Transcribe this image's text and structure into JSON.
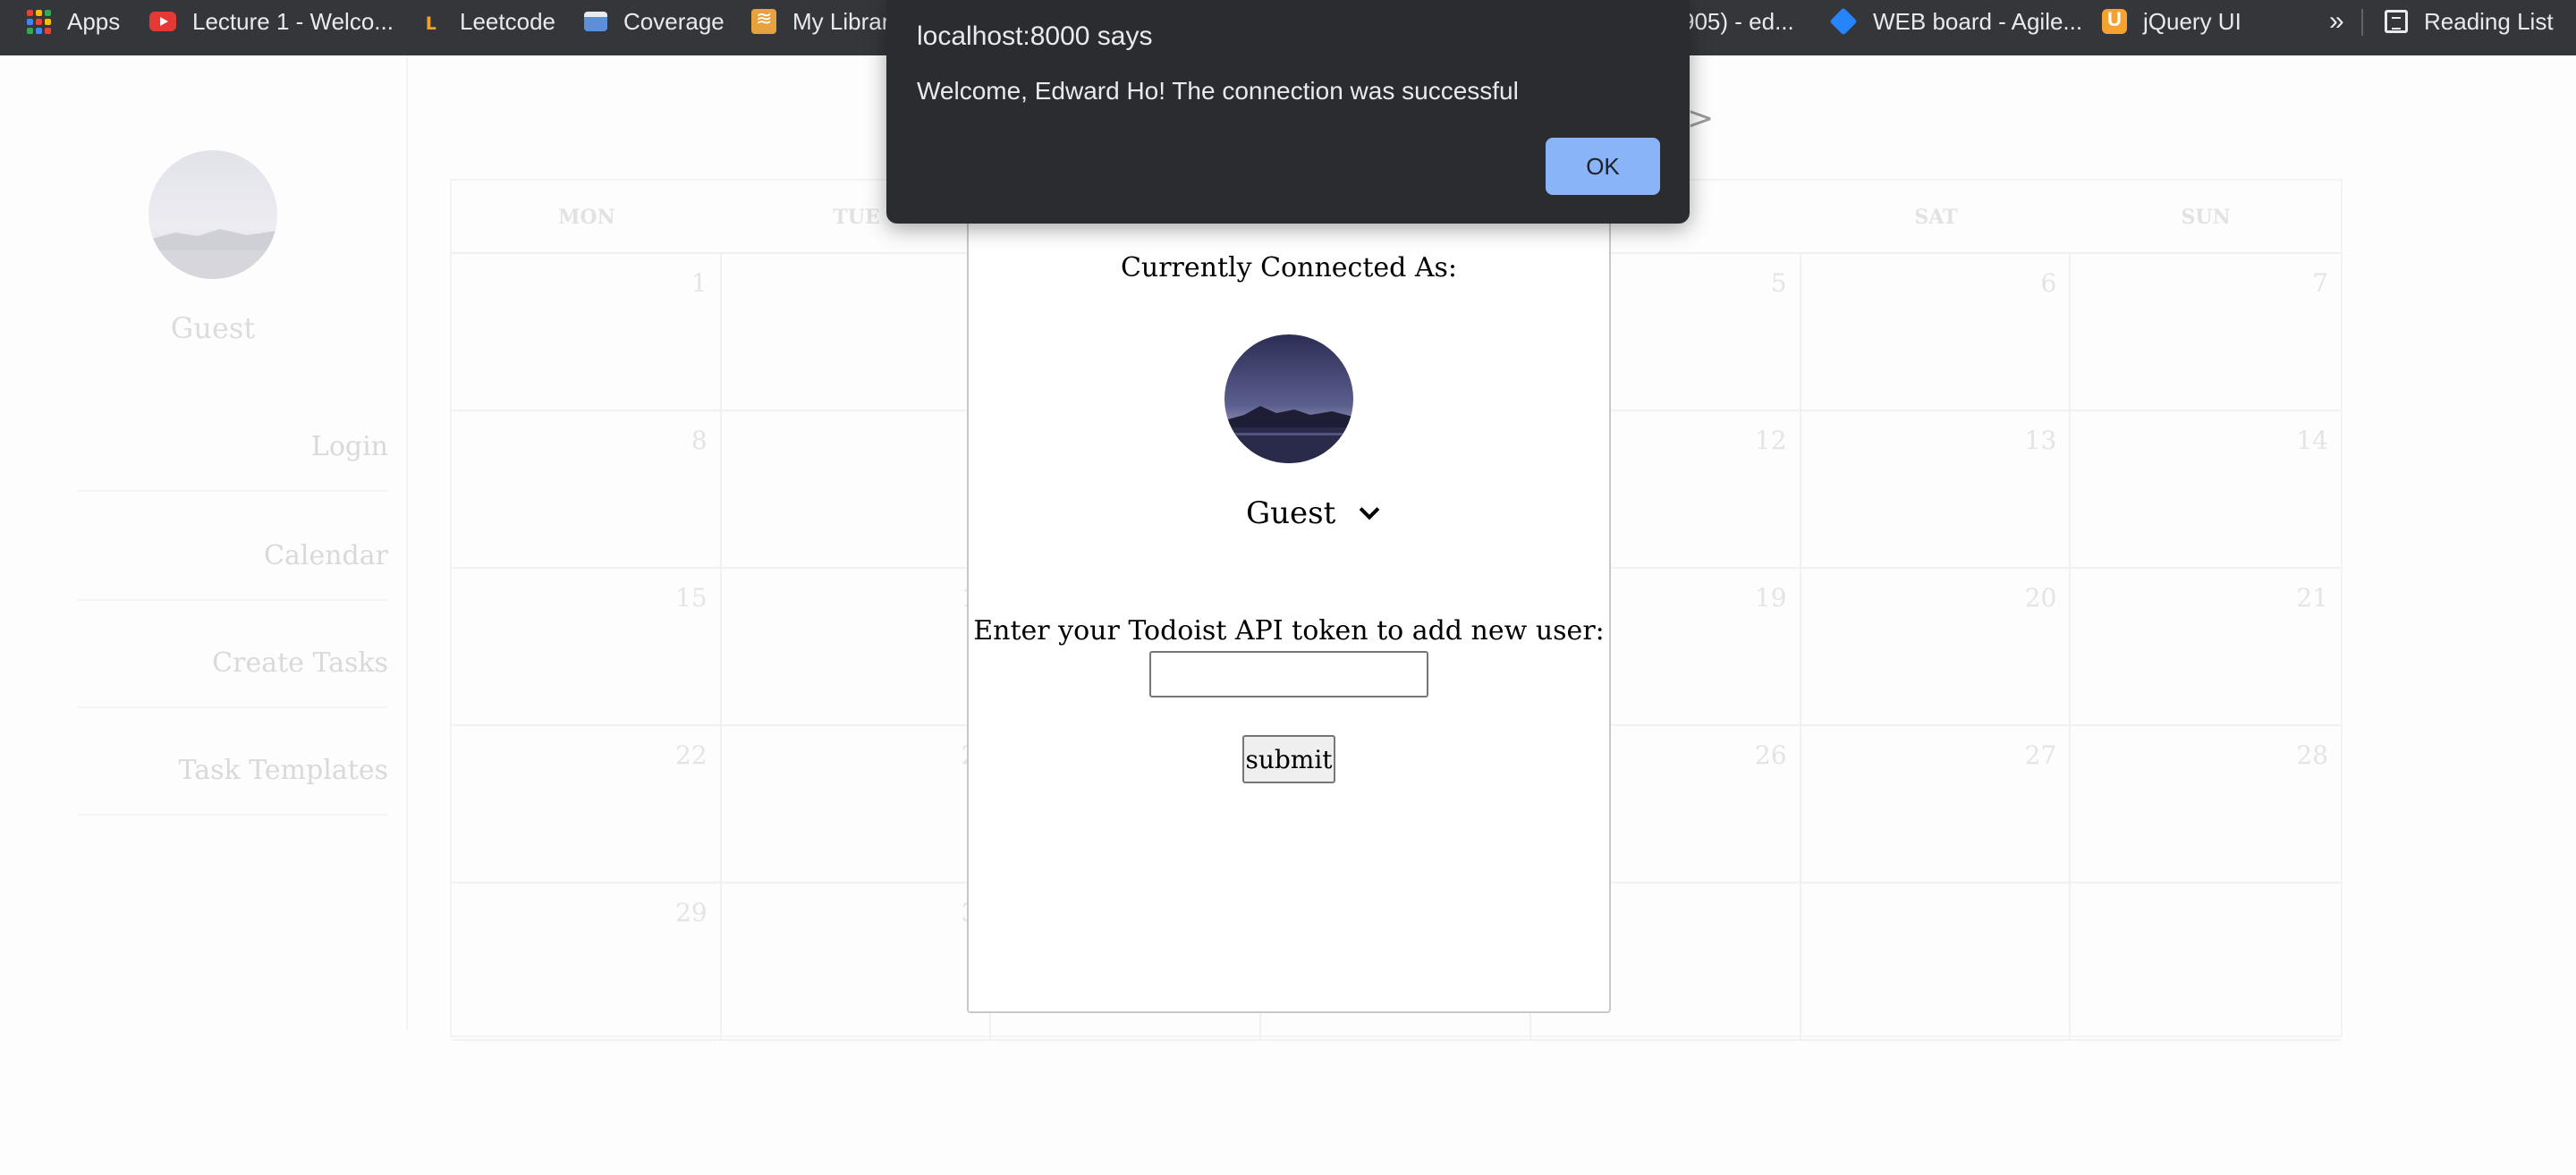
{
  "bookmarks": {
    "apps": "Apps",
    "lecture": "Lecture 1 - Welco...",
    "leetcode": "Leetcode",
    "coverage": "Coverage",
    "library": "My Librar",
    "edtab": "905) - ed...",
    "webboard": "WEB board - Agile...",
    "jqueryui": "jQuery UI",
    "overflow": "»",
    "reading_list": "Reading List"
  },
  "alert": {
    "title": "localhost:8000 says",
    "message": "Welcome, Edward Ho! The connection was successful",
    "ok_label": "OK"
  },
  "sidebar": {
    "user_name": "Guest",
    "nav": [
      "Login",
      "Calendar",
      "Create Tasks",
      "Task Templates"
    ]
  },
  "calendar": {
    "next_arrow": ">",
    "days": [
      "MON",
      "TUE",
      "",
      "",
      "",
      "SAT",
      "SUN"
    ],
    "cells": [
      "1",
      "",
      "",
      "",
      "5",
      "6",
      "7",
      "8",
      "",
      "",
      "",
      "12",
      "13",
      "14",
      "15",
      "1",
      "",
      "",
      "19",
      "20",
      "21",
      "22",
      "2",
      "",
      "",
      "26",
      "27",
      "28",
      "29",
      "3",
      "",
      "",
      "",
      "",
      ""
    ]
  },
  "modal": {
    "title": "Currently Connected As:",
    "selected_user": "Guest",
    "token_label": "Enter your Todoist API token to add new user:",
    "token_value": "",
    "submit_label": "submit"
  }
}
